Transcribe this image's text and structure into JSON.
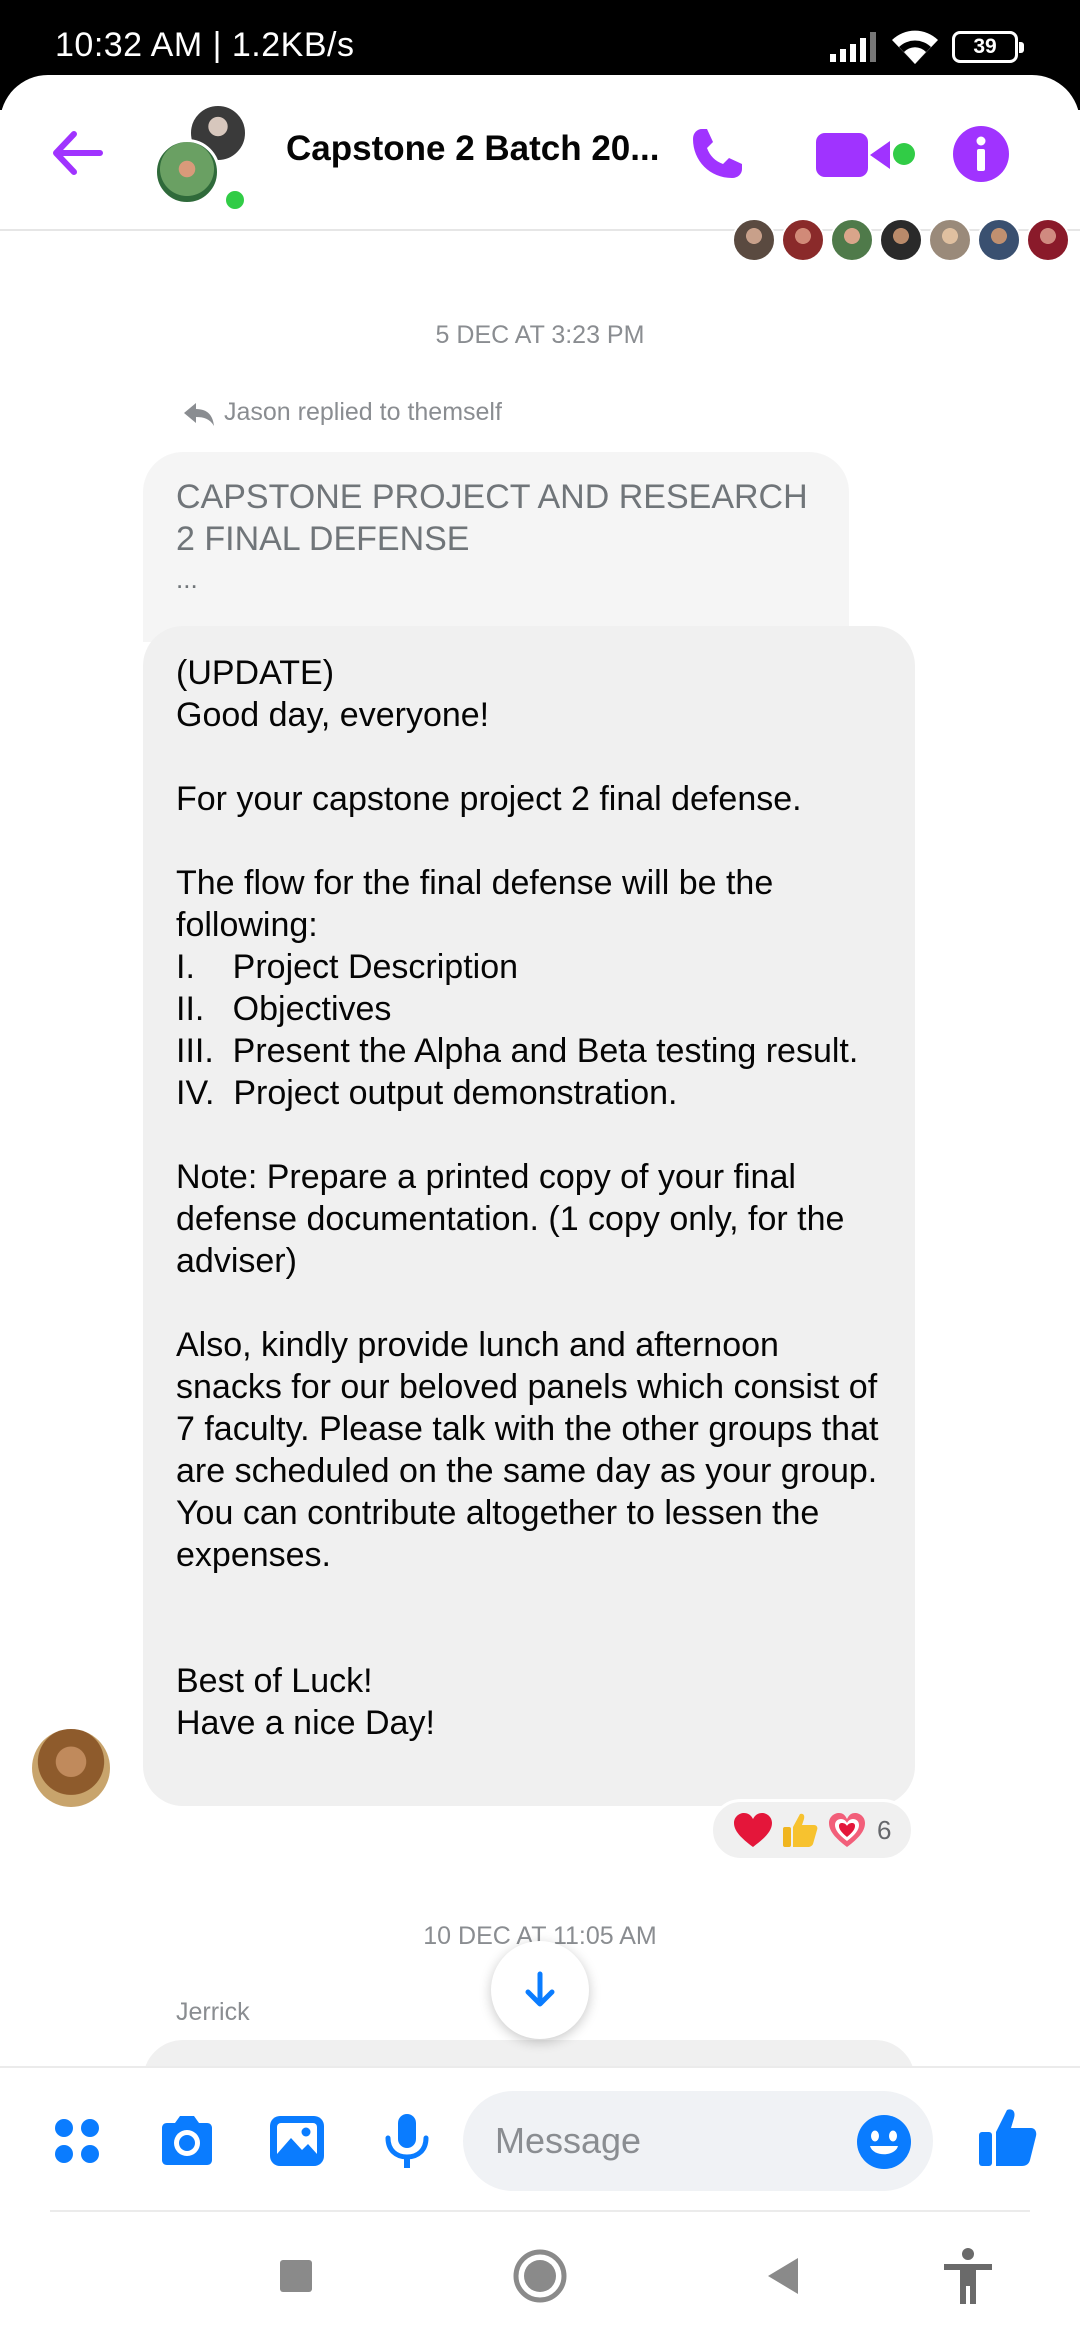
{
  "status_bar": {
    "time_net": "10:32 AM | 1.2KB/s",
    "battery": "39"
  },
  "header": {
    "title": "Capstone 2 Batch 20...",
    "accent_color": "#a033ff",
    "online_color": "#31cc46",
    "icons": [
      "back-arrow-icon",
      "phone-icon",
      "video-camera-icon",
      "info-icon"
    ]
  },
  "thread": {
    "timestamp_1": "5 DEC AT 3:23 PM",
    "reply_note": "Jason replied to themself",
    "quoted": {
      "text": "CAPSTONE PROJECT AND RESEARCH 2 FINAL DEFENSE",
      "ellipsis": "..."
    },
    "message": {
      "text": "(UPDATE)\nGood day, everyone!\n\nFor your capstone project 2 final defense.\n\nThe flow for the final defense will be the following:\nI.    Project Description\nII.   Objectives\nIII.  Present the Alpha and Beta testing result.\nIV.  Project output demonstration.\n\nNote: Prepare a printed copy of your final defense documentation. (1 copy only, for the adviser)\n\nAlso, kindly provide lunch and afternoon snacks for our beloved panels which consist of 7 faculty. Please talk with the other groups that are scheduled on the same day as your group. You can contribute altogether to lessen the expenses.\n\n\nBest of Luck!\nHave a nice Day!"
    },
    "reactions": {
      "emojis": [
        "❤️",
        "👍",
        "💓"
      ],
      "count": "6"
    },
    "timestamp_2": "10 DEC AT 11:05 AM",
    "next_sender": "Jerrick"
  },
  "composer": {
    "placeholder": "Message",
    "icons": [
      "apps-grid-icon",
      "camera-icon",
      "gallery-icon",
      "microphone-icon",
      "emoji-icon",
      "thumbs-up-icon"
    ],
    "accent_color": "#0a7cff"
  },
  "nav_bar": {
    "icons": [
      "recents-square-icon",
      "home-circle-icon",
      "back-triangle-icon",
      "accessibility-icon"
    ]
  }
}
